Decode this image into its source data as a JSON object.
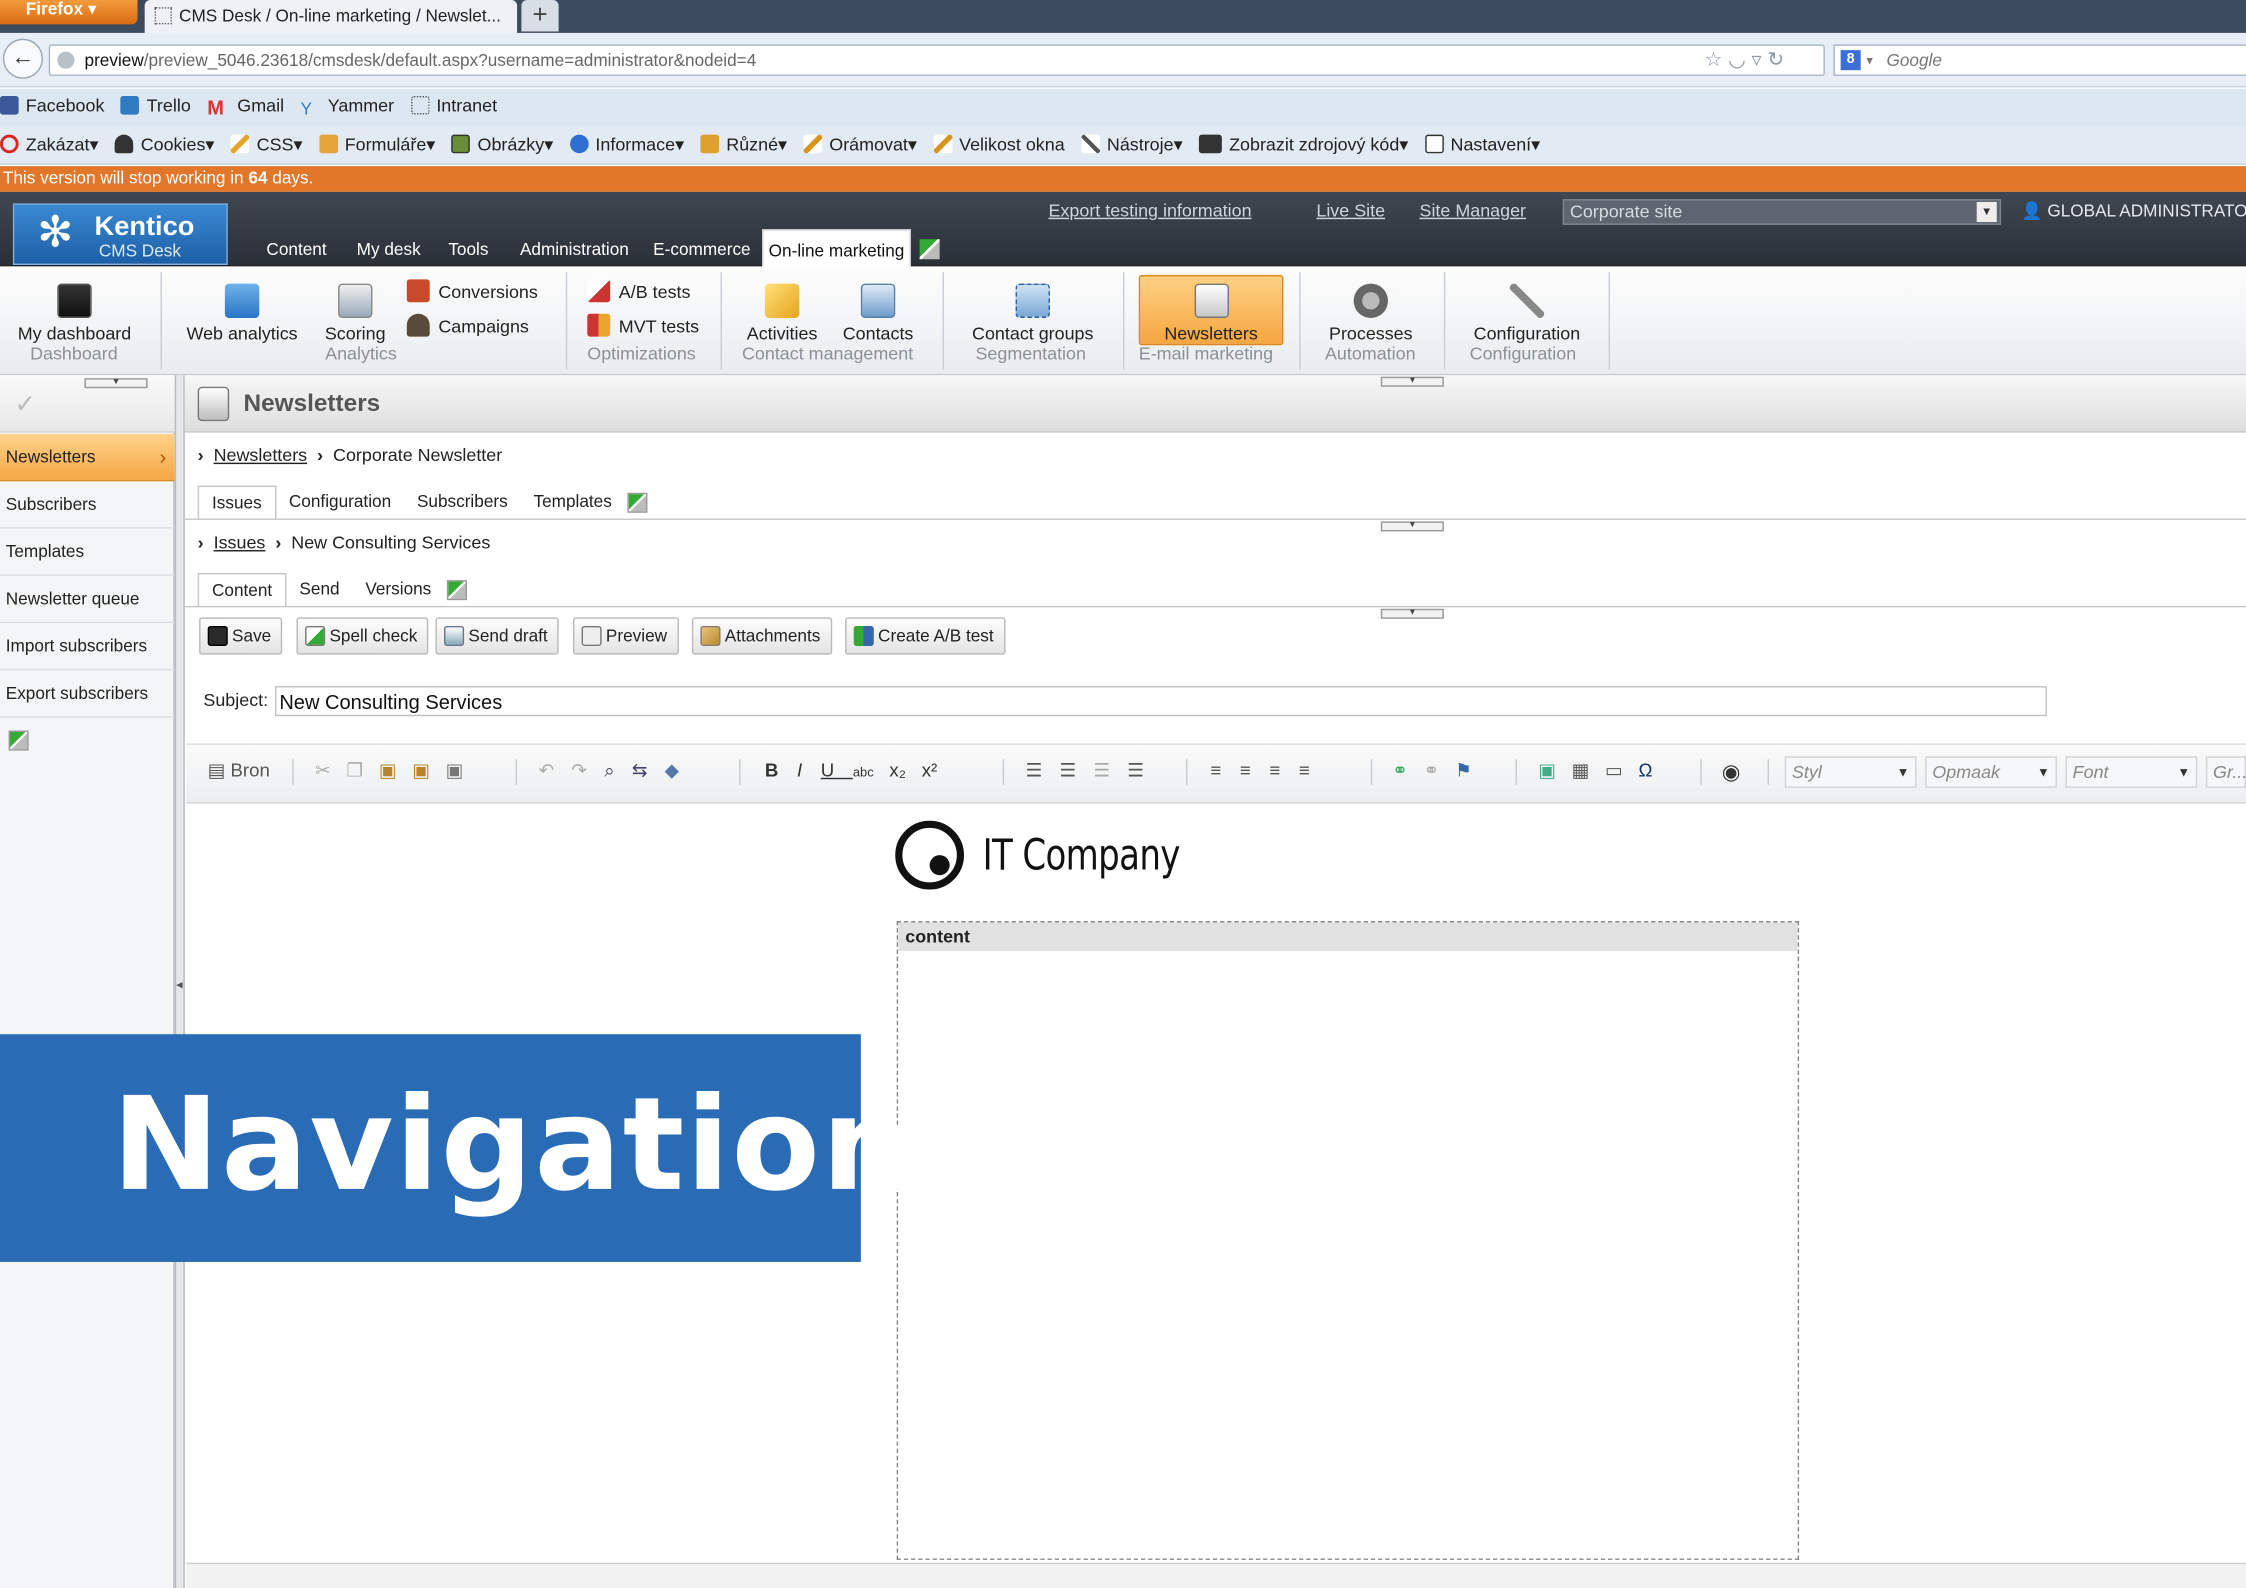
{
  "browser": {
    "menu_button": "Firefox",
    "tab_title": "CMS Desk / On-line marketing / Newslet...",
    "new_tab": "+",
    "url_host": "preview",
    "url_rest": "/preview_5046.23618/cmsdesk/default.aspx?username=administrator&nodeid=4",
    "search_placeholder": "Google",
    "bookmarks": [
      "Facebook",
      "Trello",
      "Gmail",
      "Yammer",
      "Intranet"
    ],
    "devtools": [
      "Zakázat",
      "Cookies",
      "CSS",
      "Formuláře",
      "Obrázky",
      "Informace",
      "Různé",
      "Orámovat",
      "Velikost okna",
      "Nástroje",
      "Zobrazit zdrojový kód",
      "Nastavení"
    ]
  },
  "warning": {
    "prefix": "This version will stop working in ",
    "days": "64",
    "suffix": " days."
  },
  "header": {
    "logo_name": "Kentico",
    "logo_sub": "CMS Desk",
    "tabs": [
      "Content",
      "My desk",
      "Tools",
      "Administration",
      "E-commerce"
    ],
    "active_tab": "On-line marketing",
    "links": [
      "Export testing information",
      "Live Site",
      "Site Manager"
    ],
    "site_select": "Corporate site",
    "user": "GLOBAL ADMINISTRATOR"
  },
  "ribbon": {
    "my_dashboard": "My dashboard",
    "web_analytics": "Web analytics",
    "scoring": "Scoring",
    "conversions": "Conversions",
    "campaigns": "Campaigns",
    "ab_tests": "A/B tests",
    "mvt_tests": "MVT tests",
    "activities": "Activities",
    "contacts": "Contacts",
    "contact_groups": "Contact groups",
    "newsletters": "Newsletters",
    "processes": "Processes",
    "configuration": "Configuration",
    "groups": [
      "Dashboard",
      "Analytics",
      "Optimizations",
      "Contact management",
      "Segmentation",
      "E-mail marketing",
      "Automation",
      "Configuration"
    ]
  },
  "sidebar": {
    "items": [
      "Newsletters",
      "Subscribers",
      "Templates",
      "Newsletter queue",
      "Import subscribers",
      "Export subscribers"
    ]
  },
  "main": {
    "title": "Newsletters",
    "breadcrumb1": {
      "link": "Newsletters",
      "current": "Corporate Newsletter"
    },
    "tabs1": [
      "Issues",
      "Configuration",
      "Subscribers",
      "Templates"
    ],
    "breadcrumb2": {
      "link": "Issues",
      "current": "New Consulting Services"
    },
    "tabs2": [
      "Content",
      "Send",
      "Versions"
    ],
    "actions": [
      "Save",
      "Spell check",
      "Send draft",
      "Preview",
      "Attachments",
      "Create A/B test"
    ],
    "subject_label": "Subject:",
    "subject_value": "New Consulting Services"
  },
  "editor": {
    "source_button": "Bron",
    "style_combo": "Styl",
    "format_combo": "Opmaak",
    "font_combo": "Font",
    "size_combo": "Gr...",
    "logo_text": "IT Company",
    "region_label": "content"
  },
  "overlay": {
    "text": "Navigation"
  },
  "colors": {
    "accent": "#f5a643",
    "overlay": "#2a6bb5",
    "header": "#2f363f",
    "warning": "#e2772a"
  }
}
